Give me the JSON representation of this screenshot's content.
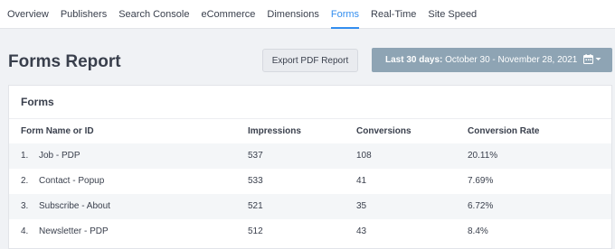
{
  "nav": {
    "tabs": [
      {
        "label": "Overview"
      },
      {
        "label": "Publishers"
      },
      {
        "label": "Search Console"
      },
      {
        "label": "eCommerce"
      },
      {
        "label": "Dimensions"
      },
      {
        "label": "Forms"
      },
      {
        "label": "Real-Time"
      },
      {
        "label": "Site Speed"
      }
    ],
    "active_tab": "Forms"
  },
  "header": {
    "title": "Forms Report",
    "export_label": "Export PDF Report",
    "date_prefix": "Last 30 days:",
    "date_range": "October 30 - November 28, 2021"
  },
  "card": {
    "title": "Forms",
    "columns": [
      "Form Name or ID",
      "Impressions",
      "Conversions",
      "Conversion Rate"
    ],
    "rows": [
      {
        "index": "1.",
        "name": "Job - PDP",
        "impressions": "537",
        "conversions": "108",
        "rate": "20.11%"
      },
      {
        "index": "2.",
        "name": "Contact - Popup",
        "impressions": "533",
        "conversions": "41",
        "rate": "7.69%"
      },
      {
        "index": "3.",
        "name": "Subscribe - About",
        "impressions": "521",
        "conversions": "35",
        "rate": "6.72%"
      },
      {
        "index": "4.",
        "name": "Newsletter - PDP",
        "impressions": "512",
        "conversions": "43",
        "rate": "8.4%"
      }
    ]
  },
  "colors": {
    "accent": "#338eef",
    "date_button": "#8ea4b4",
    "background": "#f0f2f5"
  },
  "icons": {
    "calendar": "calendar-icon",
    "dropdown": "caret-down-icon"
  }
}
